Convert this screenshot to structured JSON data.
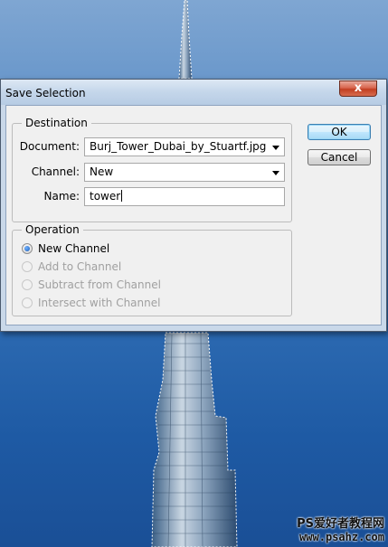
{
  "dialog": {
    "title": "Save Selection",
    "close_glyph": "x",
    "destination": {
      "legend": "Destination",
      "document_label": "Document:",
      "document_value": "Burj_Tower_Dubai_by_Stuartf.jpg",
      "channel_label": "Channel:",
      "channel_value": "New",
      "name_label": "Name:",
      "name_value": "tower"
    },
    "operation": {
      "legend": "Operation",
      "options": [
        {
          "label": "New Channel",
          "checked": true,
          "enabled": true
        },
        {
          "label": "Add to Channel",
          "checked": false,
          "enabled": false
        },
        {
          "label": "Subtract from Channel",
          "checked": false,
          "enabled": false
        },
        {
          "label": "Intersect with Channel",
          "checked": false,
          "enabled": false
        }
      ]
    },
    "buttons": {
      "ok": "OK",
      "cancel": "Cancel"
    }
  },
  "watermark": {
    "line1": "PS爱好者教程网",
    "line2": "www.psahz.com"
  },
  "colors": {
    "sky_top": "#7fa6d2",
    "sky_bottom": "#1a4f96",
    "dialog_frame": "#c9d8e9",
    "close_button": "#c23f22"
  },
  "icons": {
    "close": "close-icon",
    "dropdown": "chevron-down-icon",
    "radio_checked": "radio-checked-icon",
    "radio_unchecked": "radio-unchecked-icon"
  }
}
